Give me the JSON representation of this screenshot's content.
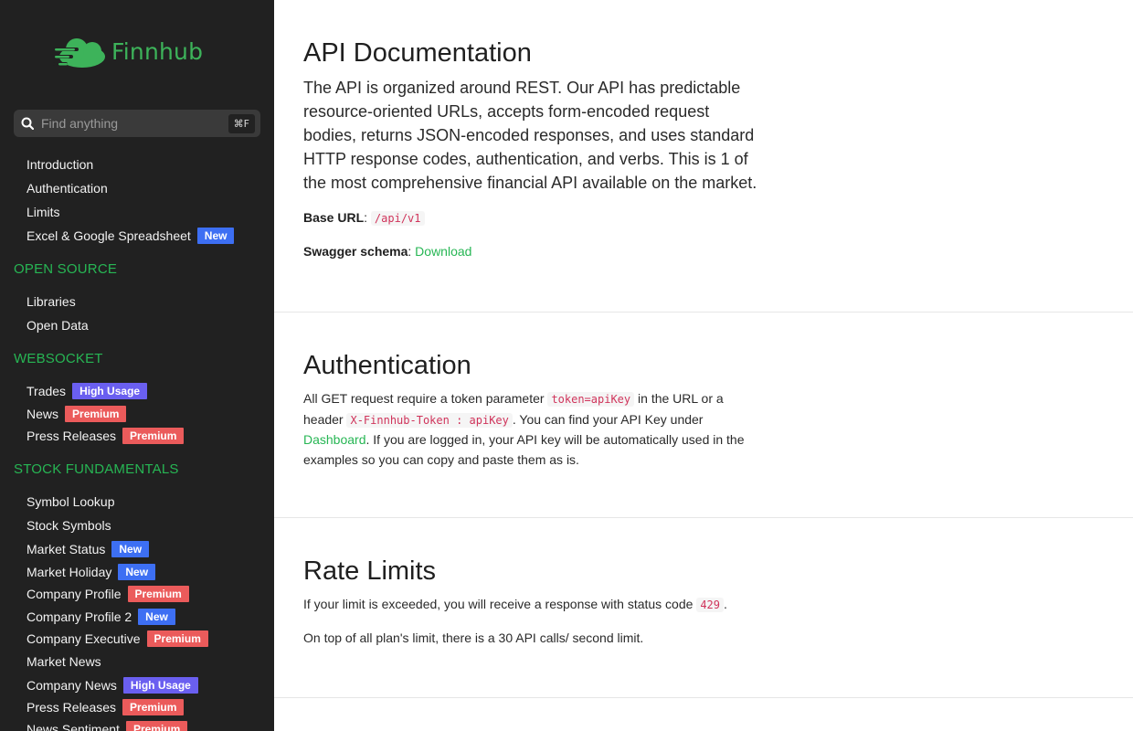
{
  "brand": {
    "name": "Finnhub",
    "color": "#3db35a"
  },
  "search": {
    "placeholder": "Find anything",
    "shortcut": "⌘F"
  },
  "badges": {
    "new": "New",
    "premium": "Premium",
    "high_usage": "High Usage"
  },
  "sidebar": {
    "top_items": [
      {
        "label": "Introduction"
      },
      {
        "label": "Authentication"
      },
      {
        "label": "Limits"
      },
      {
        "label": "Excel & Google Spreadsheet",
        "badge": "New"
      }
    ],
    "sections": [
      {
        "title": "OPEN SOURCE",
        "items": [
          {
            "label": "Libraries"
          },
          {
            "label": "Open Data"
          }
        ]
      },
      {
        "title": "WEBSOCKET",
        "items": [
          {
            "label": "Trades",
            "badge": "High Usage"
          },
          {
            "label": "News",
            "badge": "Premium"
          },
          {
            "label": "Press Releases",
            "badge": "Premium"
          }
        ]
      },
      {
        "title": "STOCK FUNDAMENTALS",
        "items": [
          {
            "label": "Symbol Lookup"
          },
          {
            "label": "Stock Symbols"
          },
          {
            "label": "Market Status",
            "badge": "New"
          },
          {
            "label": "Market Holiday",
            "badge": "New"
          },
          {
            "label": "Company Profile",
            "badge": "Premium"
          },
          {
            "label": "Company Profile 2",
            "badge": "New"
          },
          {
            "label": "Company Executive",
            "badge": "Premium"
          },
          {
            "label": "Market News"
          },
          {
            "label": "Company News",
            "badge": "High Usage"
          },
          {
            "label": "Press Releases",
            "badge": "Premium"
          },
          {
            "label": "News Sentiment",
            "badge": "Premium"
          }
        ]
      }
    ]
  },
  "main": {
    "api_docs": {
      "title": "API Documentation",
      "lead": "The API is organized around REST. Our API has predictable resource-oriented URLs, accepts form-encoded request bodies, returns JSON-encoded responses, and uses standard HTTP response codes, authentication, and verbs. This is 1 of the most comprehensive financial API available on the market.",
      "base_url_label": "Base URL",
      "base_url_value": "/api/v1",
      "swagger_label": "Swagger schema",
      "swagger_link": "Download"
    },
    "authentication": {
      "title": "Authentication",
      "text_1": "All GET request require a token parameter ",
      "code_1": "token=apiKey",
      "text_2": " in the URL or a header ",
      "code_2": "X-Finnhub-Token : apiKey",
      "text_3": ". You can find your API Key under ",
      "link": "Dashboard",
      "text_4": ". If you are logged in, your API key will be automatically used in the examples so you can copy and paste them as is."
    },
    "rate_limits": {
      "title": "Rate Limits",
      "text_1": "If your limit is exceeded, you will receive a response with status code ",
      "code": "429",
      "text_2": ".",
      "text_3": "On top of all plan's limit, there is a 30 API calls/ second limit."
    }
  }
}
